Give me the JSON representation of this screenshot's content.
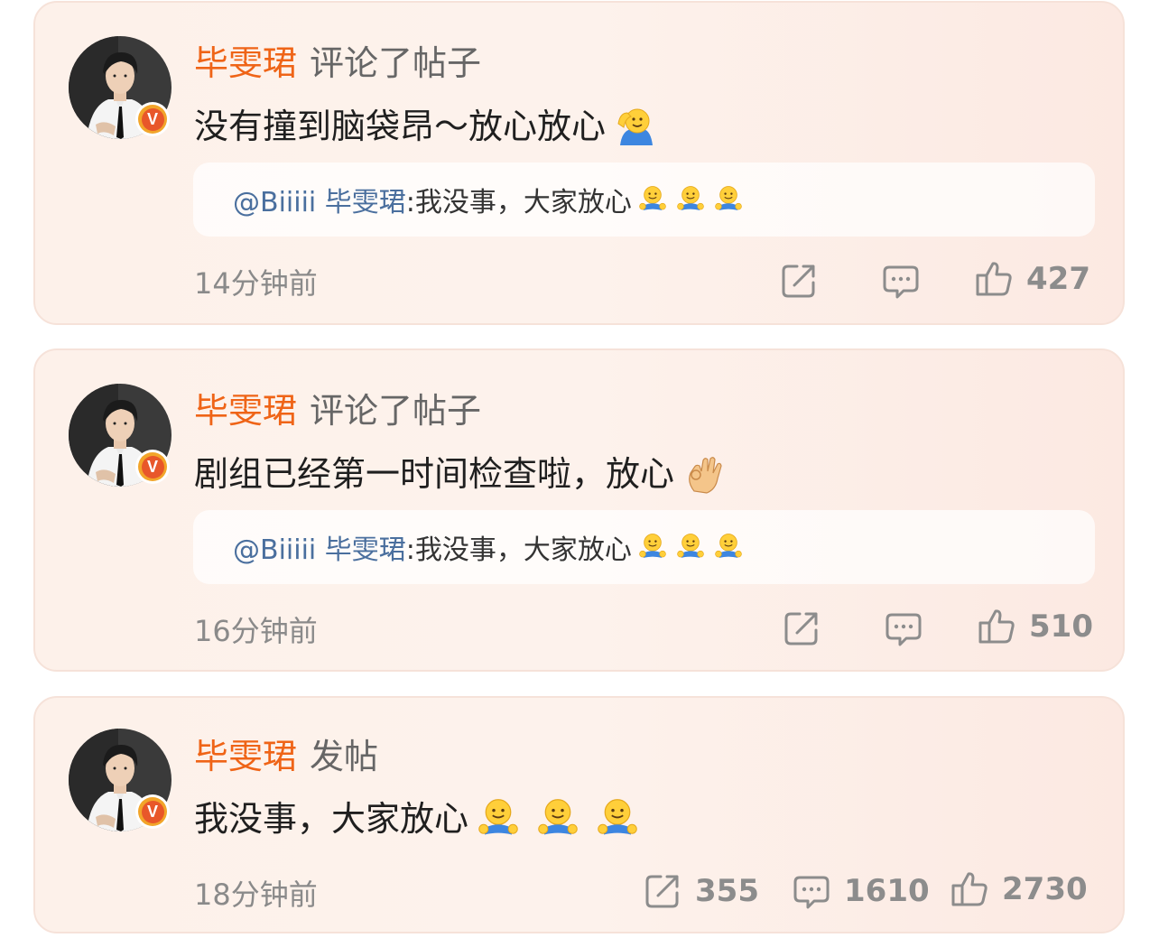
{
  "posts": [
    {
      "username": "毕雯珺",
      "action": "评论了帖子",
      "text": "没有撞到脑袋昂～放心放心",
      "emoji": "salute-emoji",
      "quote": {
        "author": "@Biiiii 毕雯珺",
        "text": ":我没事，大家放心"
      },
      "time": "14分钟前",
      "likes": "427"
    },
    {
      "username": "毕雯珺",
      "action": "评论了帖子",
      "text": "剧组已经第一时间检查啦，放心",
      "emoji": "ok-hand-emoji",
      "quote": {
        "author": "@Biiiii 毕雯珺",
        "text": ":我没事，大家放心"
      },
      "time": "16分钟前",
      "likes": "510"
    },
    {
      "username": "毕雯珺",
      "action": "发帖",
      "text": "我没事，大家放心",
      "emoji": "hug-emoji",
      "time": "18分钟前",
      "shares": "355",
      "comments": "1610",
      "likes": "2730"
    }
  ],
  "badge": {
    "label": "V"
  },
  "colors": {
    "username": "#ef6417",
    "quote_author": "#4a6f9e",
    "badge": "#e8572a"
  }
}
